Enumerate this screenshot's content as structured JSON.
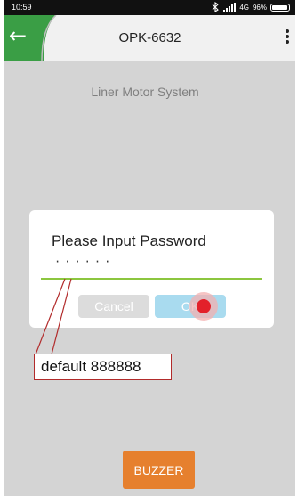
{
  "status_bar": {
    "time": "10:59",
    "network": "4G",
    "battery": "96%",
    "icons": [
      "bluetooth-icon",
      "signal-icon",
      "battery-icon"
    ]
  },
  "app_bar": {
    "back_icon": "←",
    "title": "OPK-6632",
    "menu_icon": "more-vert-icon",
    "accent_color": "#3a9e45"
  },
  "main": {
    "subtitle": "Liner Motor System",
    "buzzer_label": "BUZZER",
    "buzzer_color": "#e6802e"
  },
  "dialog": {
    "title": "Please Input Password",
    "password_masked": "······",
    "cancel_label": "Cancel",
    "ok_label": "OK"
  },
  "annotation": {
    "text": "default 888888",
    "color": "#b22b2b"
  }
}
